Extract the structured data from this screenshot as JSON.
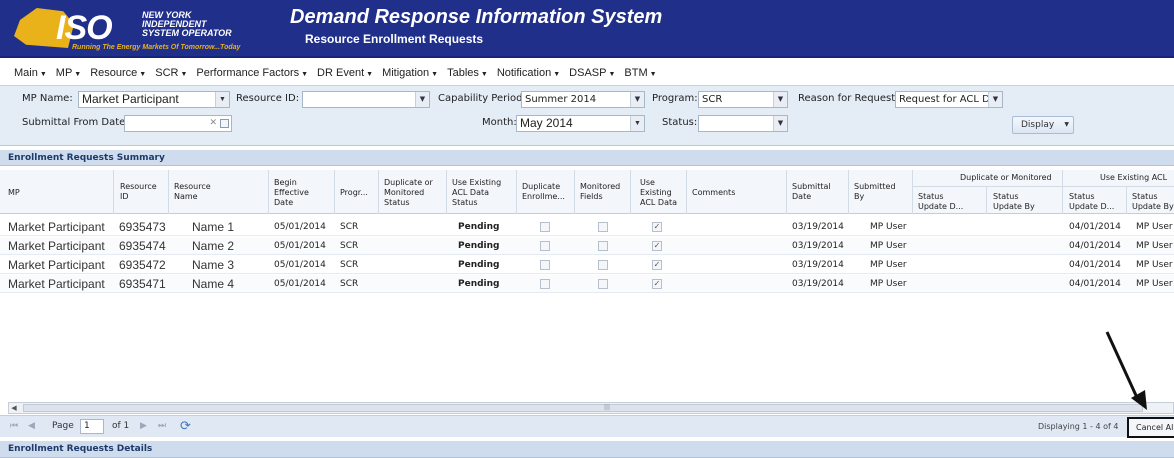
{
  "header": {
    "logo": {
      "wordmark": "ISO",
      "org_lines": [
        "NEW YORK",
        "INDEPENDENT",
        "SYSTEM OPERATOR"
      ],
      "tagline": "Running The Energy Markets Of Tomorrow...Today"
    },
    "app_title": "Demand Response Information System",
    "page_subtitle": "Resource Enrollment Requests"
  },
  "menu": [
    {
      "label": "Main"
    },
    {
      "label": "MP"
    },
    {
      "label": "Resource"
    },
    {
      "label": "SCR"
    },
    {
      "label": "Performance Factors"
    },
    {
      "label": "DR Event"
    },
    {
      "label": "Mitigation"
    },
    {
      "label": "Tables"
    },
    {
      "label": "Notification"
    },
    {
      "label": "DSASP"
    },
    {
      "label": "BTM"
    }
  ],
  "filters": {
    "mp_name": {
      "label": "MP Name:",
      "value": "Market Participant"
    },
    "resource_id": {
      "label": "Resource ID:",
      "value": ""
    },
    "capability_period": {
      "label": "Capability Period:",
      "value": "Summer 2014"
    },
    "program": {
      "label": "Program:",
      "value": "SCR"
    },
    "reason": {
      "label": "Reason for Request:",
      "value": "Request for ACL Da"
    },
    "submittal_from_date": {
      "label": "Submittal From Date:",
      "value": ""
    },
    "month": {
      "label": "Month:",
      "value": "May 2014"
    },
    "status": {
      "label": "Status:",
      "value": ""
    },
    "display_button": "Display"
  },
  "summary": {
    "title": "Enrollment Requests Summary",
    "group_headers": {
      "dup_mon": "Duplicate or Monitored",
      "use_acl": "Use Existing ACL"
    },
    "columns": {
      "mp": "MP",
      "resource_id": [
        "Resource",
        "ID"
      ],
      "resource_name": [
        "Resource",
        "Name"
      ],
      "begin_date": [
        "Begin",
        "Effective",
        "Date"
      ],
      "program": [
        "Progr..."
      ],
      "dup_mon_status": [
        "Duplicate or",
        "Monitored",
        "Status"
      ],
      "use_acl_status": [
        "Use Existing",
        "ACL Data",
        "Status"
      ],
      "dup_enroll": [
        "Duplicate",
        "Enrollme..."
      ],
      "monitored_fields": [
        "Monitored",
        "Fields"
      ],
      "use_existing_acl": [
        "Use",
        "Existing",
        "ACL Data"
      ],
      "comments": [
        "Comments"
      ],
      "submittal_date": [
        "Submittal",
        "Date"
      ],
      "submitted_by": [
        "Submitted",
        "By"
      ],
      "dm_update_date": [
        "Status",
        "Update D..."
      ],
      "dm_update_by": [
        "Status",
        "Update By"
      ],
      "acl_update_date": [
        "Status",
        "Update D..."
      ],
      "acl_update_by": [
        "Status",
        "Update By"
      ]
    },
    "rows": [
      {
        "mp": "Market Participant",
        "resource_id": "6935473",
        "resource_name": "Name 1",
        "begin_date": "05/01/2014",
        "program": "SCR",
        "use_acl_status": "Pending",
        "dup_enroll": false,
        "monitored": false,
        "use_existing_acl": true,
        "submittal_date": "03/19/2014",
        "submitted_by": "MP User",
        "acl_update_date": "04/01/2014",
        "acl_update_by": "MP User"
      },
      {
        "mp": "Market Participant",
        "resource_id": "6935474",
        "resource_name": "Name 2",
        "begin_date": "05/01/2014",
        "program": "SCR",
        "use_acl_status": "Pending",
        "dup_enroll": false,
        "monitored": false,
        "use_existing_acl": true,
        "submittal_date": "03/19/2014",
        "submitted_by": "MP User",
        "acl_update_date": "04/01/2014",
        "acl_update_by": "MP User"
      },
      {
        "mp": "Market Participant",
        "resource_id": "6935472",
        "resource_name": "Name 3",
        "begin_date": "05/01/2014",
        "program": "SCR",
        "use_acl_status": "Pending",
        "dup_enroll": false,
        "monitored": false,
        "use_existing_acl": true,
        "submittal_date": "03/19/2014",
        "submitted_by": "MP User",
        "acl_update_date": "04/01/2014",
        "acl_update_by": "MP User"
      },
      {
        "mp": "Market Participant",
        "resource_id": "6935471",
        "resource_name": "Name 4",
        "begin_date": "05/01/2014",
        "program": "SCR",
        "use_acl_status": "Pending",
        "dup_enroll": false,
        "monitored": false,
        "use_existing_acl": true,
        "submittal_date": "03/19/2014",
        "submitted_by": "MP User",
        "acl_update_date": "04/01/2014",
        "acl_update_by": "MP User"
      }
    ]
  },
  "pager": {
    "page_label": "Page",
    "page_value": "1",
    "of_label": "of 1",
    "displaying": "Displaying 1 - 4 of 4",
    "cancel_button": "Cancel Al"
  },
  "details": {
    "title": "Enrollment Requests Details"
  },
  "colors": {
    "header_bg": "#1f2f8a",
    "accent_gold": "#e9b21a",
    "panel_bg": "#e4ecf6",
    "section_bg": "#cfdced"
  },
  "icons": {
    "checkbox_checked": "✓",
    "dropdown": "▼",
    "refresh": "⟳"
  }
}
